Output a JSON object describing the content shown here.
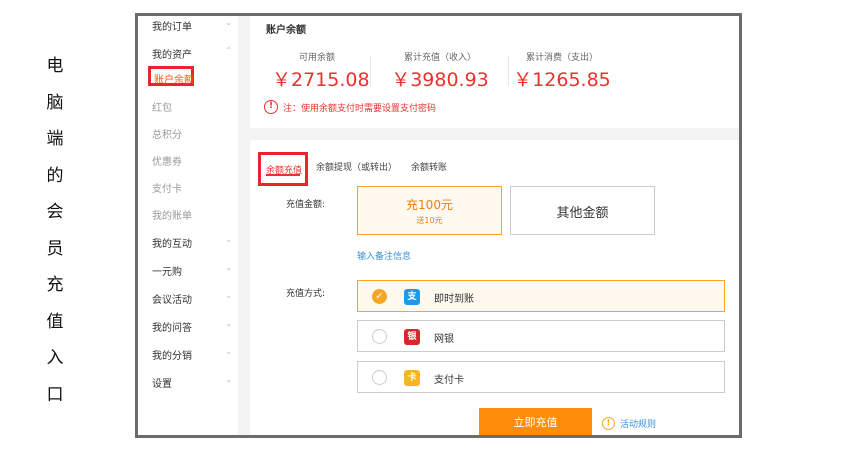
{
  "side_label": [
    "电",
    "脑",
    "端",
    "的",
    "会",
    "员",
    "充",
    "值",
    "入",
    "口"
  ],
  "sidebar": {
    "items": [
      {
        "label": "我的订单",
        "chev": "⌄"
      },
      {
        "label": "我的资产",
        "chev": "⌃"
      },
      {
        "label": "账户余额"
      },
      {
        "label": "红包"
      },
      {
        "label": "总积分"
      },
      {
        "label": "优惠券"
      },
      {
        "label": "支付卡"
      },
      {
        "label": "我的账单"
      },
      {
        "label": "我的互动",
        "chev": "⌄"
      },
      {
        "label": "一元购",
        "chev": "⌄"
      },
      {
        "label": "会议活动",
        "chev": "⌄"
      },
      {
        "label": "我的问答",
        "chev": "⌄"
      },
      {
        "label": "我的分销",
        "chev": "⌄"
      },
      {
        "label": "设置",
        "chev": "⌄"
      }
    ]
  },
  "balance": {
    "title": "账户余额",
    "available_label": "可用余额",
    "available_value": "￥2715.08",
    "recharged_label": "累计充值（收入）",
    "recharged_value": "￥3980.93",
    "spent_label": "累计消费（支出）",
    "spent_value": "￥1265.85",
    "warning_icon": "!",
    "warning": "注：使用余额支付时需要设置支付密码"
  },
  "tabs": {
    "recharge": "余额充值",
    "withdraw": "余额提现（或转出）",
    "transfer": "余额转账"
  },
  "recharge": {
    "amount_label": "充值金额:",
    "option1_main": "充100元",
    "option1_bonus": "送10元",
    "other": "其他金额",
    "note_link": "输入备注信息",
    "method_label": "充值方式:",
    "methods": [
      {
        "label": "即时到账",
        "icon": "alipay-icon",
        "icon_glyph": "支",
        "color": "#1c9bea",
        "checked": "✓"
      },
      {
        "label": "网银",
        "icon": "unionpay-icon",
        "icon_glyph": "银",
        "color": "#d6262e",
        "checked": ""
      },
      {
        "label": "支付卡",
        "icon": "card-icon",
        "icon_glyph": "卡",
        "color": "#f5b623",
        "checked": ""
      }
    ],
    "submit": "立即充值",
    "rules_icon": "!",
    "rules": "活动规则"
  }
}
